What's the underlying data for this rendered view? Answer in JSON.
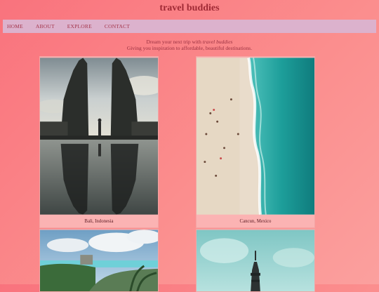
{
  "site": {
    "title": "travel buddies"
  },
  "nav": {
    "items": [
      {
        "label": "HOME"
      },
      {
        "label": "ABOUT"
      },
      {
        "label": "EXPLORE"
      },
      {
        "label": "CONTACT"
      }
    ]
  },
  "tagline": {
    "line1_prefix": "Dream your next trip with",
    "brand": "travel buddies",
    "line2": "Giving you inspiration to affordable, beautiful destinations."
  },
  "destinations": [
    {
      "caption": "Bali, Indonesia",
      "image": "temple-gate-photo"
    },
    {
      "caption": "Cancun, Mexico",
      "image": "aerial-beach-photo"
    },
    {
      "caption": "",
      "image": "tulum-ruins-photo"
    },
    {
      "caption": "",
      "image": "tower-photo"
    }
  ]
}
